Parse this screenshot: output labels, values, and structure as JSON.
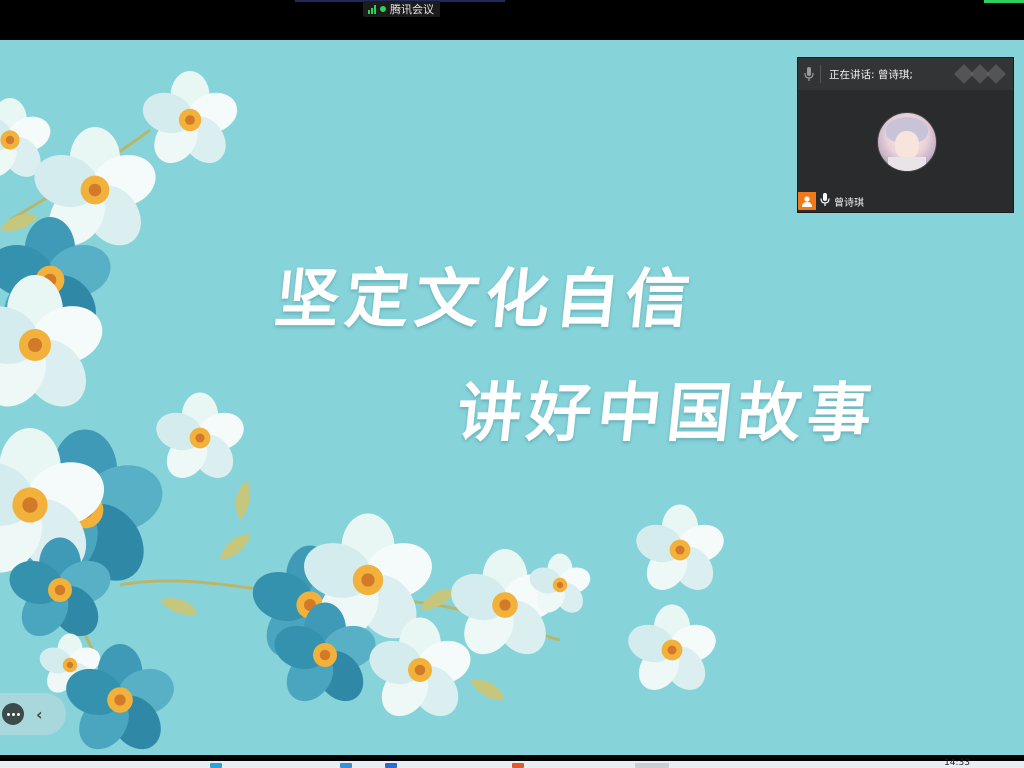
{
  "meeting": {
    "app_name": "腾讯会议",
    "colors": {
      "signal": "#2fd15b",
      "bar": "#000000"
    }
  },
  "slide": {
    "title_line1": "坚定文化自信",
    "title_line2": "讲好中国故事",
    "colors": {
      "background": "#87d3da",
      "text": "#ffffff"
    }
  },
  "video_panel": {
    "speaking_label": "正在讲话: 曾诗琪;",
    "participant_name": "曾诗琪",
    "icons": [
      "mic-icon",
      "user-badge-icon",
      "mic-on-icon",
      "drag-grip-icon"
    ]
  },
  "toolbar": {
    "more_icon": "more-icon",
    "collapse_symbol": "‹"
  },
  "taskbar": {
    "clock": "14:33"
  }
}
